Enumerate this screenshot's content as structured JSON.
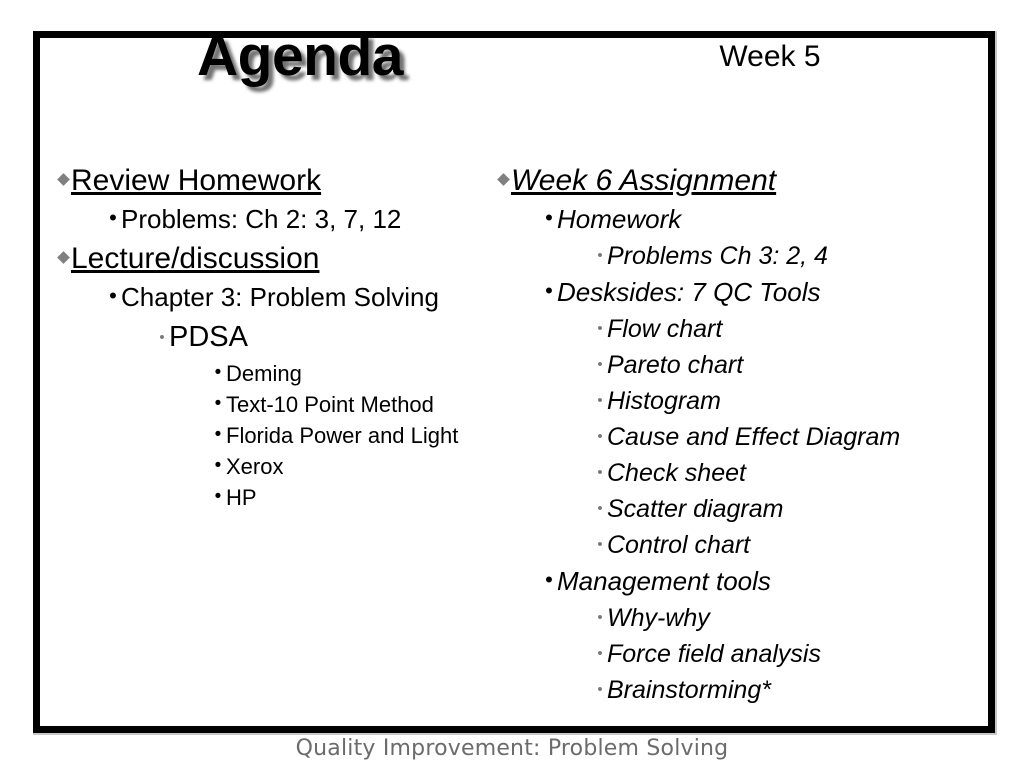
{
  "slide": {
    "title": "Agenda",
    "week_label": "Week 5",
    "footer": "Quality Improvement: Problem Solving",
    "colors": {
      "text": "#000000",
      "level1_bullet": "#808080",
      "level3_bullet": "#7a7a7a",
      "frame_border": "#000000",
      "footer_text": "#6b6b6b",
      "background": "#ffffff"
    },
    "bullet_glyphs": {
      "level1": "diamond-bullet",
      "level2": "round-bullet",
      "level3": "small-round-bullet",
      "level4": "round-bullet"
    }
  },
  "left_column": {
    "items": [
      {
        "level": 1,
        "text": "Review Homework"
      },
      {
        "level": 2,
        "text": "Problems: Ch 2: 3, 7, 12"
      },
      {
        "level": 1,
        "text": "Lecture/discussion"
      },
      {
        "level": 2,
        "text": "Chapter 3: Problem Solving"
      },
      {
        "level": 3,
        "text": "PDSA"
      },
      {
        "level": 4,
        "text": "Deming"
      },
      {
        "level": 4,
        "text": "Text-10 Point Method"
      },
      {
        "level": 4,
        "text": "Florida Power and Light"
      },
      {
        "level": 4,
        "text": "Xerox"
      },
      {
        "level": 4,
        "text": "HP"
      }
    ]
  },
  "right_column": {
    "items": [
      {
        "level": 1,
        "text": "Week 6 Assignment"
      },
      {
        "level": 2,
        "text": "Homework"
      },
      {
        "level": 3,
        "text": "Problems Ch 3: 2, 4"
      },
      {
        "level": 2,
        "text": "Desksides: 7 QC Tools"
      },
      {
        "level": 3,
        "text": "Flow chart"
      },
      {
        "level": 3,
        "text": "Pareto chart"
      },
      {
        "level": 3,
        "text": "Histogram"
      },
      {
        "level": 3,
        "text": "Cause and Effect Diagram"
      },
      {
        "level": 3,
        "text": "Check sheet"
      },
      {
        "level": 3,
        "text": "Scatter diagram"
      },
      {
        "level": 3,
        "text": "Control chart"
      },
      {
        "level": 2,
        "text": "Management tools"
      },
      {
        "level": 3,
        "text": "Why-why"
      },
      {
        "level": 3,
        "text": "Force field analysis"
      },
      {
        "level": 3,
        "text": "Brainstorming*"
      }
    ]
  }
}
